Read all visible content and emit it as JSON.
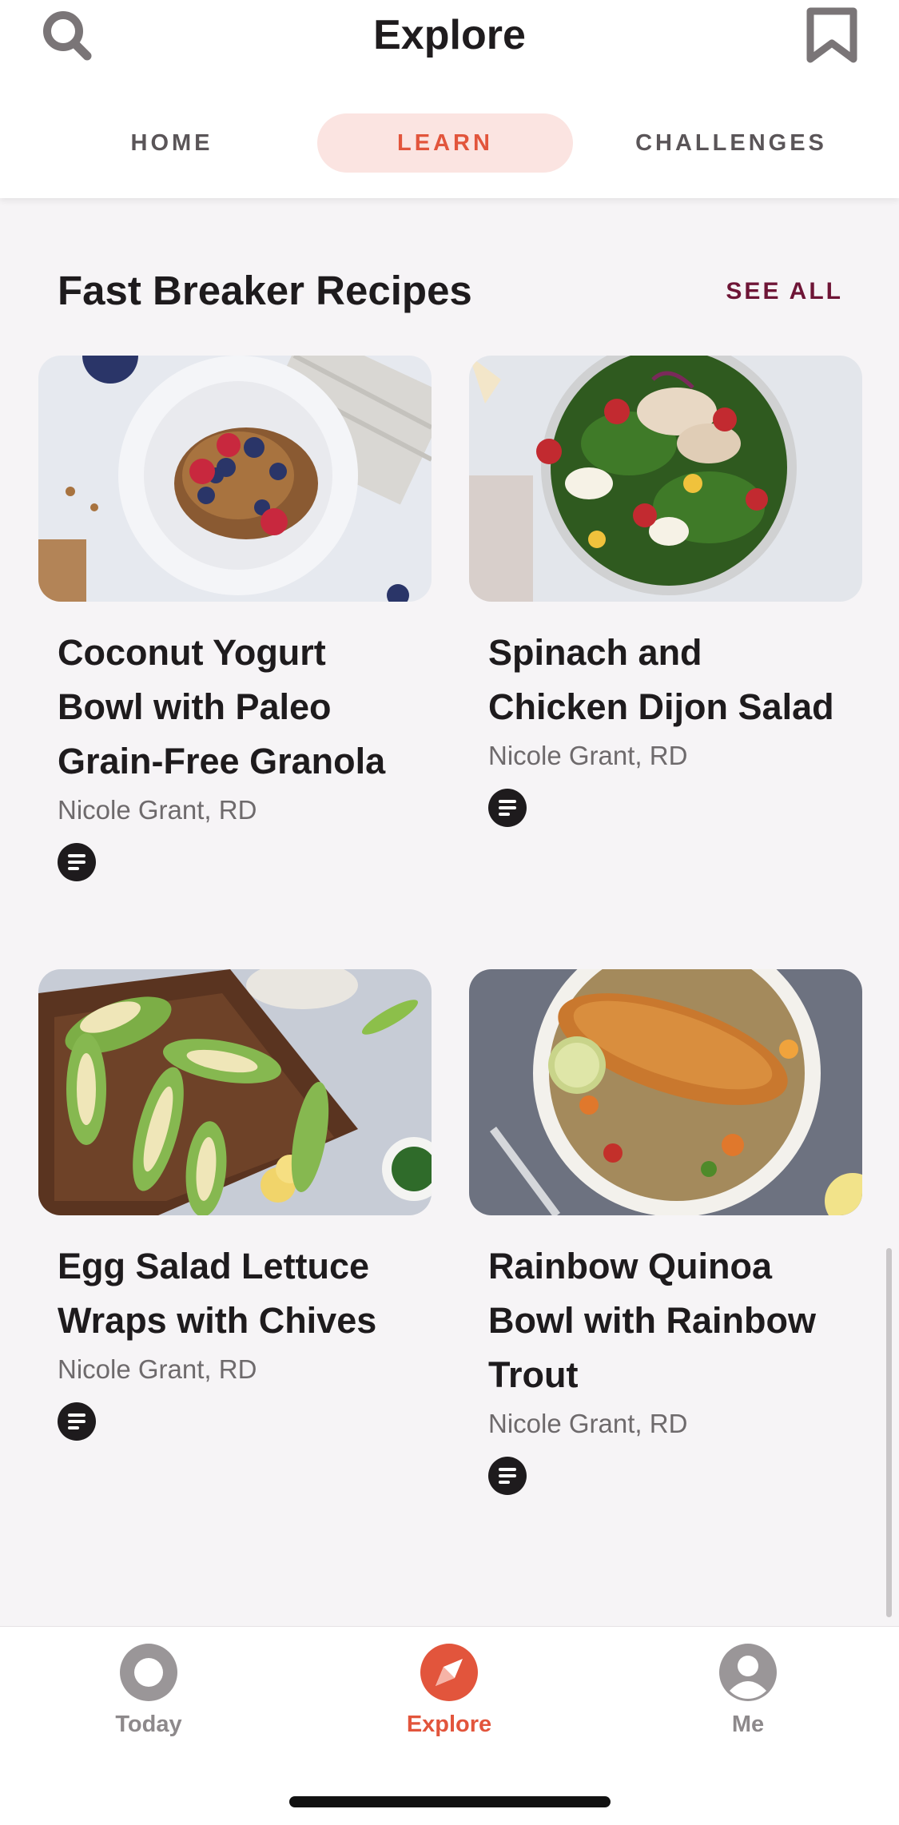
{
  "header": {
    "title": "Explore",
    "search_icon": "search-icon",
    "bookmark_icon": "bookmark-icon",
    "tabs": [
      {
        "label": "HOME",
        "active": false
      },
      {
        "label": "LEARN",
        "active": true
      },
      {
        "label": "CHALLENGES",
        "active": false
      }
    ]
  },
  "section": {
    "title": "Fast Breaker Recipes",
    "see_all": "SEE ALL",
    "cards": [
      {
        "title": "Coconut Yogurt Bowl with Paleo Grain-Free Granola",
        "author": "Nicole Grant, RD",
        "badge_icon": "article-icon"
      },
      {
        "title": "Spinach and Chicken Dijon Salad",
        "author": "Nicole Grant, RD",
        "badge_icon": "article-icon"
      },
      {
        "title": "Egg Salad Lettuce Wraps with Chives",
        "author": "Nicole Grant, RD",
        "badge_icon": "article-icon"
      },
      {
        "title": "Rainbow Quinoa Bowl with Rainbow Trout",
        "author": "Nicole Grant, RD",
        "badge_icon": "article-icon"
      }
    ]
  },
  "bottom_nav": {
    "items": [
      {
        "label": "Today",
        "icon": "ring-icon",
        "active": false
      },
      {
        "label": "Explore",
        "icon": "compass-icon",
        "active": true
      },
      {
        "label": "Me",
        "icon": "profile-icon",
        "active": false
      }
    ]
  },
  "colors": {
    "accent": "#e2553c",
    "accent_soft": "#fbe4e1",
    "see_all": "#6e1536",
    "background": "#f6f4f6",
    "inactive": "#8d898b"
  }
}
